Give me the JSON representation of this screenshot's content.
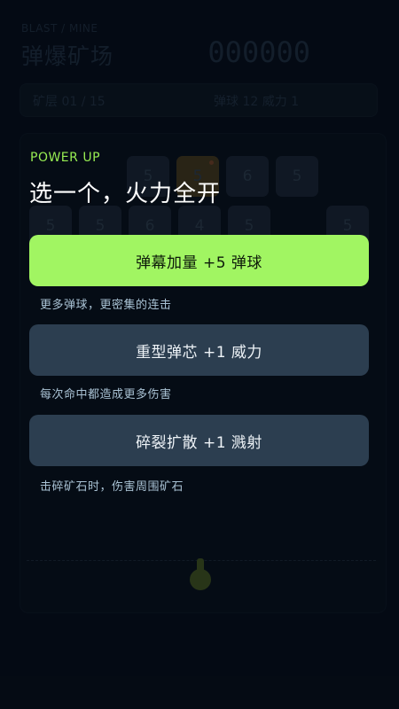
{
  "header": {
    "brand": "BLAST / MINE",
    "title": "弹爆矿场",
    "score": "000000"
  },
  "status": {
    "layer_label": "矿层 01 / 15",
    "ammo_label": "弹球 12  威力 1"
  },
  "board": {
    "ores": [
      {
        "value": "5",
        "gold": false
      },
      {
        "value": "5",
        "gold": true
      },
      {
        "value": "6",
        "gold": false
      },
      {
        "value": "5",
        "gold": false
      },
      {
        "value": "5",
        "gold": false
      },
      {
        "value": "5",
        "gold": false
      },
      {
        "value": "6",
        "gold": false
      },
      {
        "value": "4",
        "gold": false
      },
      {
        "value": "5",
        "gold": false
      },
      {
        "value": "5",
        "gold": false
      }
    ]
  },
  "powerup": {
    "tag": "POWER UP",
    "title": "选一个，火力全开",
    "options": [
      {
        "label": "弹幕加量  +5 弹球",
        "description": "更多弹球，更密集的连击"
      },
      {
        "label": "重型弹芯  +1 威力",
        "description": "每次命中都造成更多伤害"
      },
      {
        "label": "碎裂扩散  +1 溅射",
        "description": "击碎矿石时，伤害周围矿石"
      }
    ]
  },
  "colors": {
    "accent": "#a1f562",
    "option_bg": "#2c3e50",
    "background": "#060c16"
  }
}
